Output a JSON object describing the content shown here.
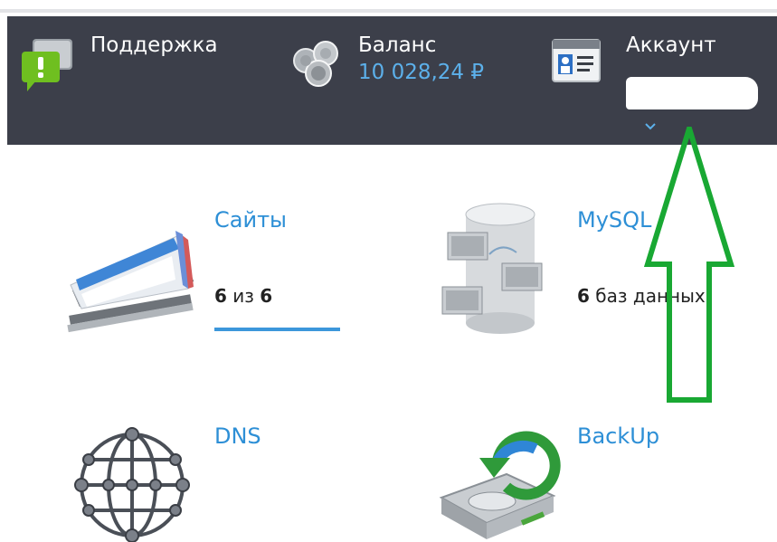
{
  "header": {
    "support": {
      "label": "Поддержка",
      "icon": "chat-bubble-icon"
    },
    "balance": {
      "label": "Баланс",
      "value": "10 028,24 ₽",
      "icon": "coins-icon"
    },
    "account": {
      "label": "Аккаунт",
      "icon": "id-card-icon"
    }
  },
  "tiles": {
    "sites": {
      "title": "Сайты",
      "count_used": "6",
      "count_sep": "из",
      "count_total": "6",
      "icon": "websites-icon"
    },
    "mysql": {
      "title": "MySQL",
      "count": "6",
      "count_label": "баз данных",
      "icon": "database-cabinet-icon"
    },
    "dns": {
      "title": "DNS",
      "icon": "network-globe-icon"
    },
    "backup": {
      "title": "BackUp",
      "icon": "backup-disk-icon"
    }
  },
  "colors": {
    "header_bg": "#3c3f4a",
    "accent": "#2d8fd6",
    "balance_value": "#5cb0ea",
    "annotation_arrow": "#19a833"
  }
}
